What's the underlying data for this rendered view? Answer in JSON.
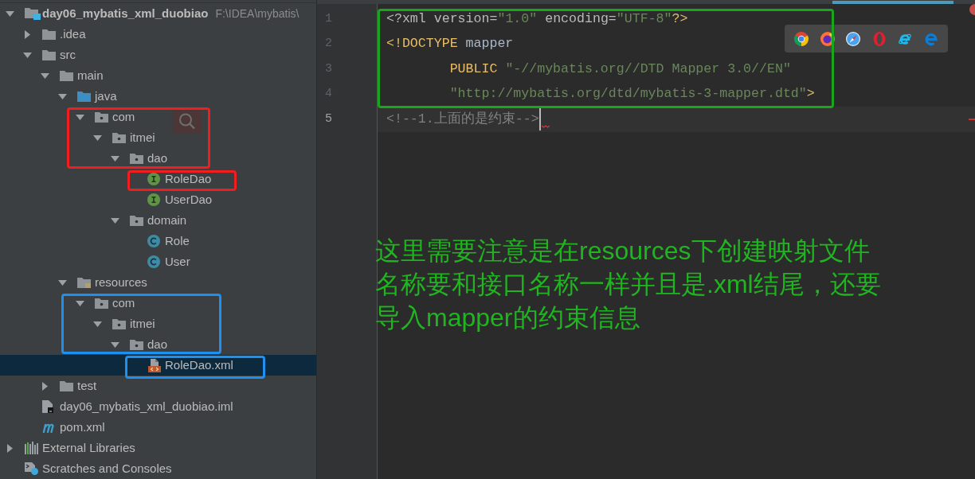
{
  "project_tree": {
    "items": [
      {
        "kind": "project",
        "label": "day06_mybatis_xml_duobiao",
        "path": "F:\\IDEA\\mybatis\\",
        "expanded": true,
        "selected": false,
        "children": [
          {
            "kind": "folder",
            "label": ".idea",
            "expanded": false,
            "selected": false
          },
          {
            "kind": "folder",
            "label": "src",
            "expanded": true,
            "selected": false,
            "children": [
              {
                "kind": "folder",
                "label": "main",
                "expanded": true,
                "selected": false,
                "children": [
                  {
                    "kind": "source_root",
                    "label": "java",
                    "expanded": true,
                    "selected": false,
                    "children": [
                      {
                        "kind": "package",
                        "label": "com",
                        "expanded": true,
                        "selected": false,
                        "children": [
                          {
                            "kind": "package",
                            "label": "itmei",
                            "expanded": true,
                            "selected": false,
                            "children": [
                              {
                                "kind": "package",
                                "label": "dao",
                                "expanded": true,
                                "selected": false,
                                "children": [
                                  {
                                    "kind": "interface",
                                    "label": "RoleDao",
                                    "selected": false
                                  },
                                  {
                                    "kind": "interface",
                                    "label": "UserDao",
                                    "selected": false
                                  }
                                ]
                              },
                              {
                                "kind": "package",
                                "label": "domain",
                                "expanded": true,
                                "selected": false,
                                "children": [
                                  {
                                    "kind": "class",
                                    "label": "Role",
                                    "selected": false
                                  },
                                  {
                                    "kind": "class",
                                    "label": "User",
                                    "selected": false
                                  }
                                ]
                              }
                            ]
                          }
                        ]
                      }
                    ]
                  },
                  {
                    "kind": "resource_root",
                    "label": "resources",
                    "expanded": true,
                    "selected": false,
                    "children": [
                      {
                        "kind": "package",
                        "label": "com",
                        "expanded": true,
                        "selected": false,
                        "children": [
                          {
                            "kind": "package",
                            "label": "itmei",
                            "expanded": true,
                            "selected": false,
                            "children": [
                              {
                                "kind": "package",
                                "label": "dao",
                                "expanded": true,
                                "selected": false,
                                "children": [
                                  {
                                    "kind": "xml",
                                    "label": "RoleDao.xml",
                                    "selected": true
                                  }
                                ]
                              }
                            ]
                          }
                        ]
                      }
                    ]
                  }
                ]
              },
              {
                "kind": "folder",
                "label": "test",
                "expanded": false,
                "selected": false
              }
            ]
          },
          {
            "kind": "module_file",
            "label": "day06_mybatis_xml_duobiao.iml",
            "selected": false
          },
          {
            "kind": "maven_file",
            "label": "pom.xml",
            "selected": false
          }
        ]
      },
      {
        "kind": "libraries",
        "label": "External Libraries",
        "expanded": false,
        "selected": false
      },
      {
        "kind": "scratches",
        "label": "Scratches and Consoles",
        "selected": false
      }
    ]
  },
  "editor": {
    "lines": [
      {
        "number": "1",
        "current": false,
        "error": false,
        "tokens": [
          {
            "kind": "attr",
            "text": "<?xml version="
          },
          {
            "kind": "value",
            "text": "\"1.0\""
          },
          {
            "kind": "attr",
            "text": " encoding="
          },
          {
            "kind": "value",
            "text": "\"UTF-8\""
          },
          {
            "kind": "tag",
            "text": "?>"
          }
        ]
      },
      {
        "number": "2",
        "current": false,
        "error": false,
        "tokens": [
          {
            "kind": "tag",
            "text": "<!DOCTYPE"
          },
          {
            "kind": "text",
            "text": " mapper"
          }
        ]
      },
      {
        "number": "3",
        "current": false,
        "error": false,
        "tokens": [
          {
            "kind": "tag",
            "text": "        PUBLIC "
          },
          {
            "kind": "value",
            "text": "\"-//mybatis.org//DTD Mapper 3.0//EN\""
          }
        ]
      },
      {
        "number": "4",
        "current": false,
        "error": false,
        "tokens": [
          {
            "kind": "value",
            "text": "        \"http://mybatis.org/dtd/mybatis-3-mapper.dtd\""
          },
          {
            "kind": "tag",
            "text": ">"
          }
        ]
      },
      {
        "number": "5",
        "current": true,
        "error": true,
        "tokens": [
          {
            "kind": "comment",
            "text": "<!--1.上面的是约束-->"
          }
        ]
      }
    ]
  },
  "browser_bar": {
    "browsers": [
      {
        "kind": "chrome"
      },
      {
        "kind": "firefox"
      },
      {
        "kind": "safari"
      },
      {
        "kind": "opera"
      },
      {
        "kind": "ie"
      },
      {
        "kind": "edge"
      }
    ]
  },
  "annotation": {
    "lines": [
      "这里需要注意是在resources下创建映射文件",
      "名称要和接口名称一样并且是.xml结尾，还要",
      "导入mapper的约束信息"
    ]
  }
}
